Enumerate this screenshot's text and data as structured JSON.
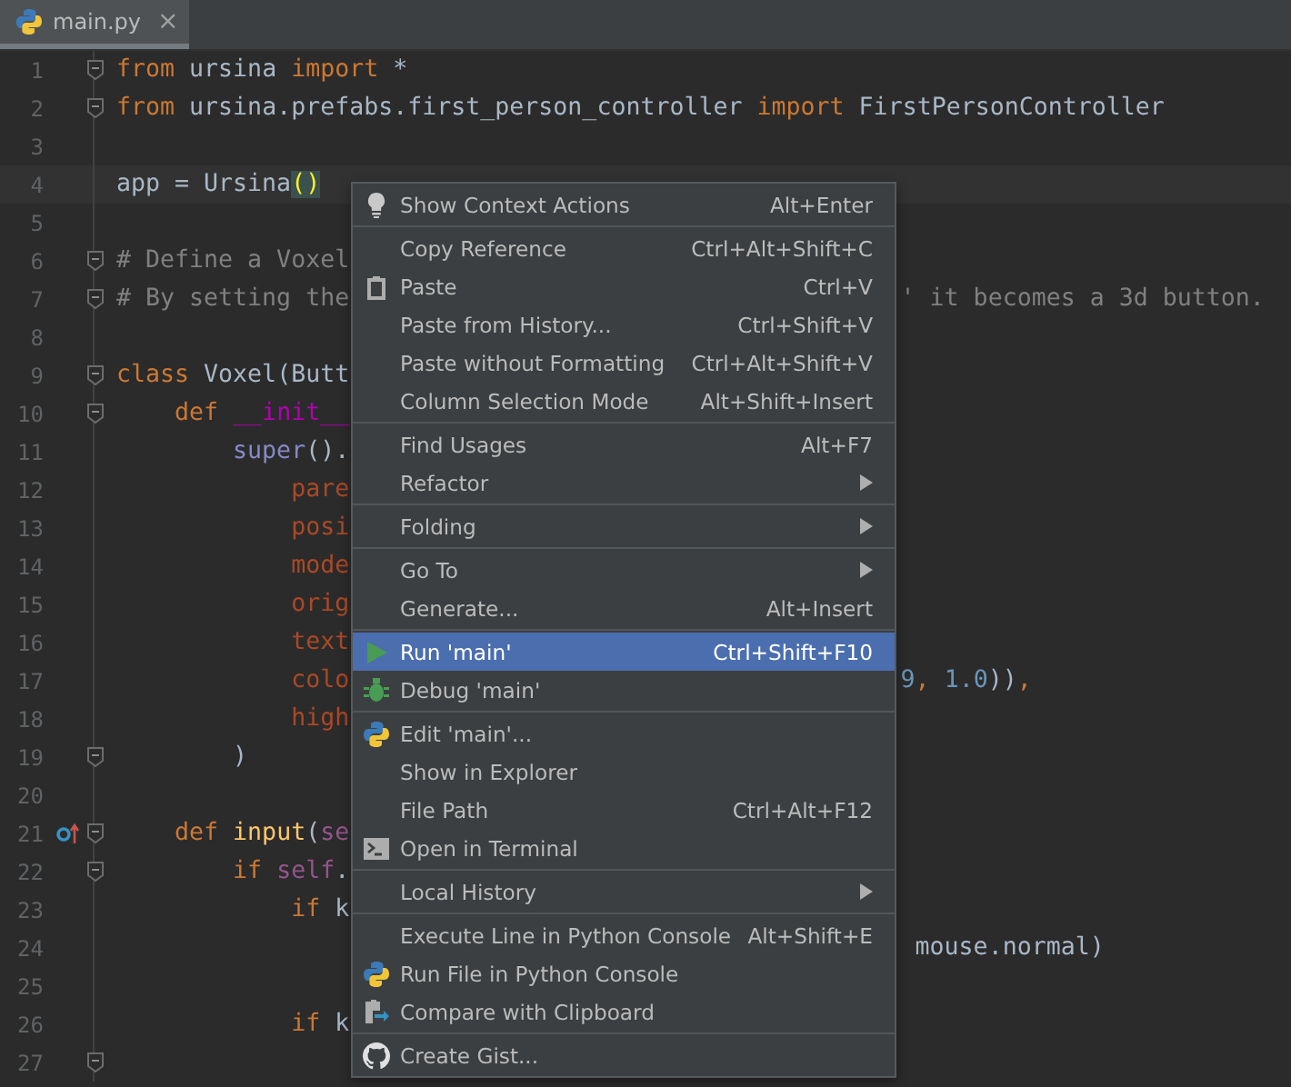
{
  "tab": {
    "title": "main.py",
    "selected": true,
    "close": "×"
  },
  "editor": {
    "lines": [
      {
        "number": "1",
        "fold": true,
        "current": false,
        "code": [
          {
            "kind": "keyword",
            "text": "from"
          },
          {
            "kind": "plain",
            "text": " ursina "
          },
          {
            "kind": "keyword",
            "text": "import"
          },
          {
            "kind": "plain",
            "text": " *"
          }
        ]
      },
      {
        "number": "2",
        "fold": true,
        "current": false,
        "code": [
          {
            "kind": "keyword",
            "text": "from"
          },
          {
            "kind": "plain",
            "text": " ursina.prefabs.first_person_controller "
          },
          {
            "kind": "keyword",
            "text": "import"
          },
          {
            "kind": "plain",
            "text": " FirstPersonController"
          }
        ]
      },
      {
        "number": "3",
        "fold": false,
        "current": false
      },
      {
        "number": "4",
        "fold": false,
        "current": true,
        "code": [
          {
            "kind": "plain",
            "text": "app = Ursina"
          },
          {
            "kind": "match",
            "text": "("
          },
          {
            "kind": "match",
            "text": ")"
          }
        ]
      },
      {
        "number": "5",
        "fold": false,
        "current": false
      },
      {
        "number": "6",
        "fold": true,
        "current": false,
        "code": [
          {
            "kind": "comment",
            "text": "# Define a Voxel"
          }
        ]
      },
      {
        "number": "7",
        "fold": true,
        "current": false,
        "code": [
          {
            "kind": "comment",
            "text": "# By setting the"
          }
        ],
        "tail": [
          {
            "kind": "comment",
            "text": "' it becomes a 3d button."
          }
        ]
      },
      {
        "number": "8",
        "fold": false,
        "current": false
      },
      {
        "number": "9",
        "fold": true,
        "current": false,
        "code": [
          {
            "kind": "keyword",
            "text": "class"
          },
          {
            "kind": "plain",
            "text": " Voxel(Butt"
          }
        ]
      },
      {
        "number": "10",
        "fold": true,
        "current": false,
        "code": [
          {
            "kind": "keyword",
            "text": "    def "
          },
          {
            "kind": "magic",
            "text": "__init__"
          }
        ]
      },
      {
        "number": "11",
        "fold": false,
        "current": false,
        "code": [
          {
            "kind": "builtin",
            "text": "        super"
          },
          {
            "kind": "plain",
            "text": "()."
          }
        ]
      },
      {
        "number": "12",
        "fold": false,
        "current": false,
        "code": [
          {
            "kind": "param",
            "text": "            pare"
          }
        ]
      },
      {
        "number": "13",
        "fold": false,
        "current": false,
        "code": [
          {
            "kind": "param",
            "text": "            posi"
          }
        ]
      },
      {
        "number": "14",
        "fold": false,
        "current": false,
        "code": [
          {
            "kind": "param",
            "text": "            mode"
          }
        ]
      },
      {
        "number": "15",
        "fold": false,
        "current": false,
        "code": [
          {
            "kind": "param",
            "text": "            orig"
          }
        ]
      },
      {
        "number": "16",
        "fold": false,
        "current": false,
        "code": [
          {
            "kind": "param",
            "text": "            text"
          }
        ]
      },
      {
        "number": "17",
        "fold": false,
        "current": false,
        "code": [
          {
            "kind": "param",
            "text": "            colo"
          }
        ],
        "tail": [
          {
            "kind": "number",
            "text": "9"
          },
          {
            "kind": "keyword",
            "text": ", "
          },
          {
            "kind": "number",
            "text": "1.0"
          },
          {
            "kind": "plain",
            "text": "))"
          },
          {
            "kind": "keyword",
            "text": ","
          }
        ]
      },
      {
        "number": "18",
        "fold": false,
        "current": false,
        "code": [
          {
            "kind": "param",
            "text": "            high"
          }
        ]
      },
      {
        "number": "19",
        "fold": true,
        "current": false,
        "code": [
          {
            "kind": "plain",
            "text": "        )"
          }
        ]
      },
      {
        "number": "20",
        "fold": false,
        "current": false
      },
      {
        "number": "21",
        "fold": true,
        "current": false,
        "override": true,
        "code": [
          {
            "kind": "keyword",
            "text": "    def "
          },
          {
            "kind": "function",
            "text": "input"
          },
          {
            "kind": "plain",
            "text": "("
          },
          {
            "kind": "self",
            "text": "se"
          }
        ]
      },
      {
        "number": "22",
        "fold": true,
        "current": false,
        "code": [
          {
            "kind": "keyword",
            "text": "        if "
          },
          {
            "kind": "self",
            "text": "self"
          },
          {
            "kind": "plain",
            "text": "."
          }
        ]
      },
      {
        "number": "23",
        "fold": false,
        "current": false,
        "code": [
          {
            "kind": "keyword",
            "text": "            if"
          },
          {
            "kind": "plain",
            "text": " k"
          }
        ]
      },
      {
        "number": "24",
        "fold": false,
        "current": false,
        "tail": [
          {
            "kind": "plain",
            "text": " mouse.normal)"
          }
        ]
      },
      {
        "number": "25",
        "fold": false,
        "current": false
      },
      {
        "number": "26",
        "fold": false,
        "current": false,
        "code": [
          {
            "kind": "keyword",
            "text": "            if"
          },
          {
            "kind": "plain",
            "text": " k"
          }
        ]
      },
      {
        "number": "27",
        "fold": true,
        "current": false
      }
    ]
  },
  "context_menu": {
    "items": [
      {
        "kind": "item",
        "label": "Show Context Actions",
        "shortcut": "Alt+Enter",
        "submenu": false,
        "selected": false
      },
      {
        "kind": "separator"
      },
      {
        "kind": "item",
        "label": "Copy Reference",
        "shortcut": "Ctrl+Alt+Shift+C",
        "submenu": false,
        "selected": false
      },
      {
        "kind": "item",
        "label": "Paste",
        "shortcut": "Ctrl+V",
        "submenu": false,
        "selected": false
      },
      {
        "kind": "item",
        "label": "Paste from History...",
        "shortcut": "Ctrl+Shift+V",
        "submenu": false,
        "selected": false
      },
      {
        "kind": "item",
        "label": "Paste without Formatting",
        "shortcut": "Ctrl+Alt+Shift+V",
        "submenu": false,
        "selected": false
      },
      {
        "kind": "item",
        "label": "Column Selection Mode",
        "shortcut": "Alt+Shift+Insert",
        "submenu": false,
        "selected": false
      },
      {
        "kind": "separator"
      },
      {
        "kind": "item",
        "label": "Find Usages",
        "shortcut": "Alt+F7",
        "submenu": false,
        "selected": false
      },
      {
        "kind": "item",
        "label": "Refactor",
        "submenu": true,
        "selected": false
      },
      {
        "kind": "separator"
      },
      {
        "kind": "item",
        "label": "Folding",
        "submenu": true,
        "selected": false
      },
      {
        "kind": "separator"
      },
      {
        "kind": "item",
        "label": "Go To",
        "submenu": true,
        "selected": false
      },
      {
        "kind": "item",
        "label": "Generate...",
        "shortcut": "Alt+Insert",
        "submenu": false,
        "selected": false
      },
      {
        "kind": "separator"
      },
      {
        "kind": "item",
        "label": "Run 'main'",
        "shortcut": "Ctrl+Shift+F10",
        "submenu": false,
        "selected": true
      },
      {
        "kind": "item",
        "label": "Debug 'main'",
        "submenu": false,
        "selected": false
      },
      {
        "kind": "separator"
      },
      {
        "kind": "item",
        "label": "Edit 'main'...",
        "submenu": false,
        "selected": false
      },
      {
        "kind": "item",
        "label": "Show in Explorer",
        "submenu": false,
        "selected": false
      },
      {
        "kind": "item",
        "label": "File Path",
        "shortcut": "Ctrl+Alt+F12",
        "submenu": false,
        "selected": false
      },
      {
        "kind": "item",
        "label": "Open in Terminal",
        "submenu": false,
        "selected": false
      },
      {
        "kind": "separator"
      },
      {
        "kind": "item",
        "label": "Local History",
        "submenu": true,
        "selected": false
      },
      {
        "kind": "separator"
      },
      {
        "kind": "item",
        "label": "Execute Line in Python Console",
        "shortcut": "Alt+Shift+E",
        "submenu": false,
        "selected": false
      },
      {
        "kind": "item",
        "label": "Run File in Python Console",
        "submenu": false,
        "selected": false
      },
      {
        "kind": "item",
        "label": "Compare with Clipboard",
        "submenu": false,
        "selected": false
      },
      {
        "kind": "separator"
      },
      {
        "kind": "item",
        "label": "Create Gist...",
        "submenu": false,
        "selected": false
      }
    ]
  }
}
